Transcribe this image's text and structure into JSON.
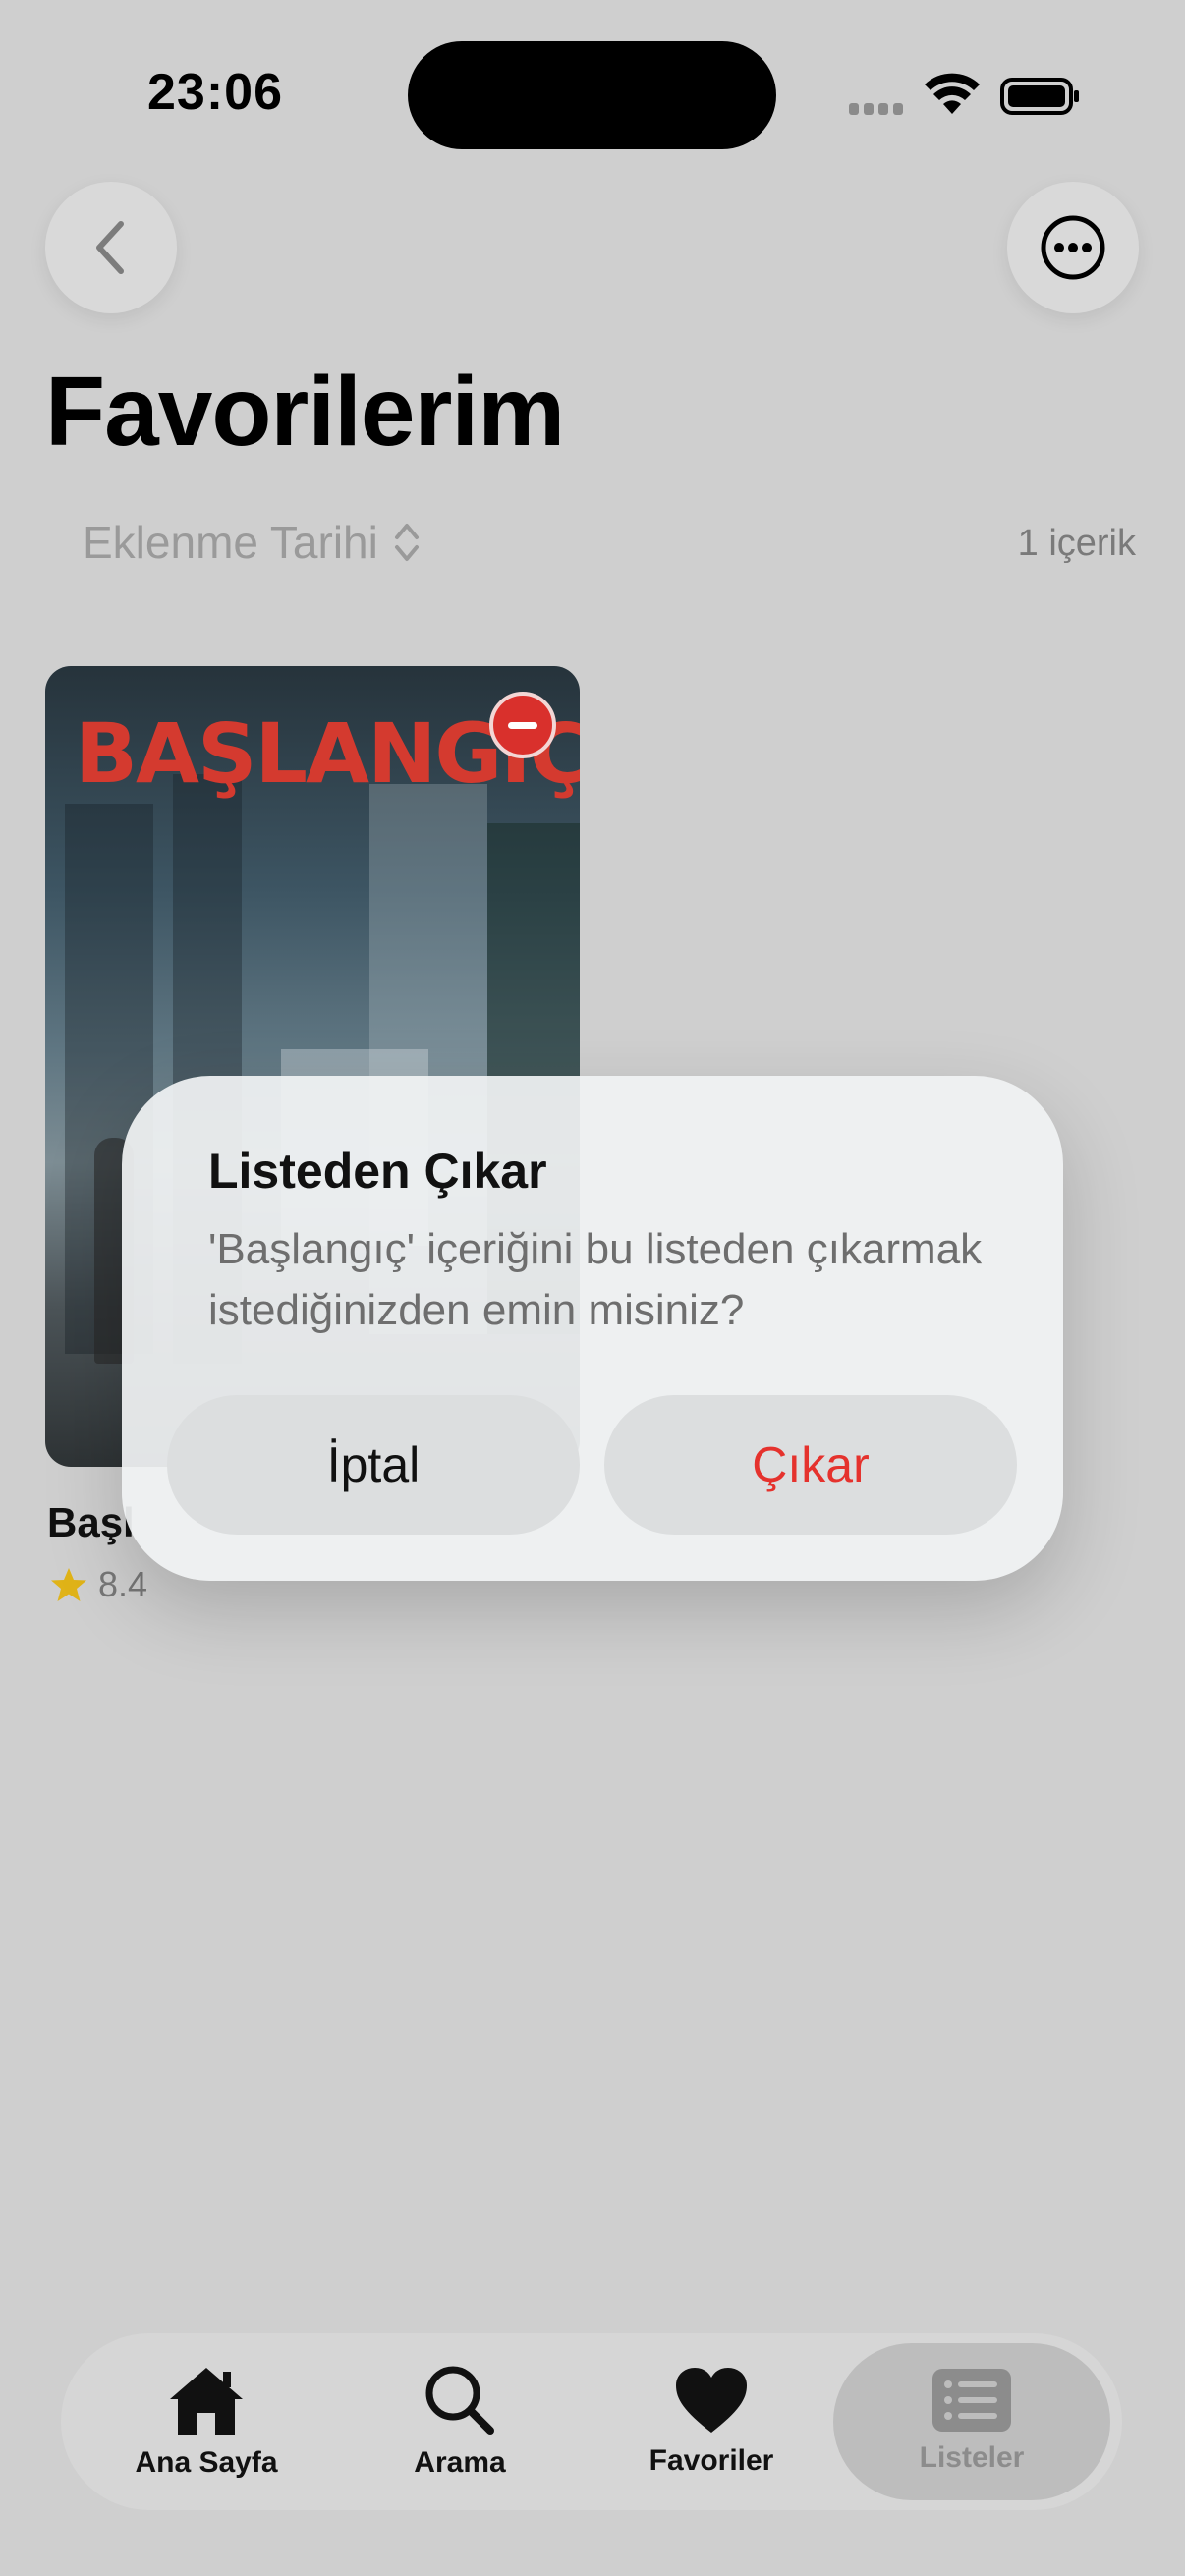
{
  "status_bar": {
    "time": "23:06"
  },
  "header": {
    "title": "Favorilerim",
    "sort_label": "Eklenme Tarihi",
    "item_count": "1 içerik"
  },
  "card": {
    "poster_title": "BAŞLANGIÇ",
    "title": "Başl",
    "rating": "8.4"
  },
  "dialog": {
    "title": "Listeden Çıkar",
    "message": "'Başlangıç' içeriğini bu listeden çıkarmak istediğinizden emin misiniz?",
    "cancel_label": "İptal",
    "confirm_label": "Çıkar"
  },
  "tabbar": {
    "items": [
      {
        "label": "Ana Sayfa",
        "icon": "home-icon"
      },
      {
        "label": "Arama",
        "icon": "search-icon"
      },
      {
        "label": "Favoriler",
        "icon": "heart-icon"
      },
      {
        "label": "Listeler",
        "icon": "list-icon",
        "active": true
      }
    ]
  },
  "colors": {
    "destructive": "#e5322d",
    "badge": "#d9302c",
    "star": "#e0b318"
  }
}
